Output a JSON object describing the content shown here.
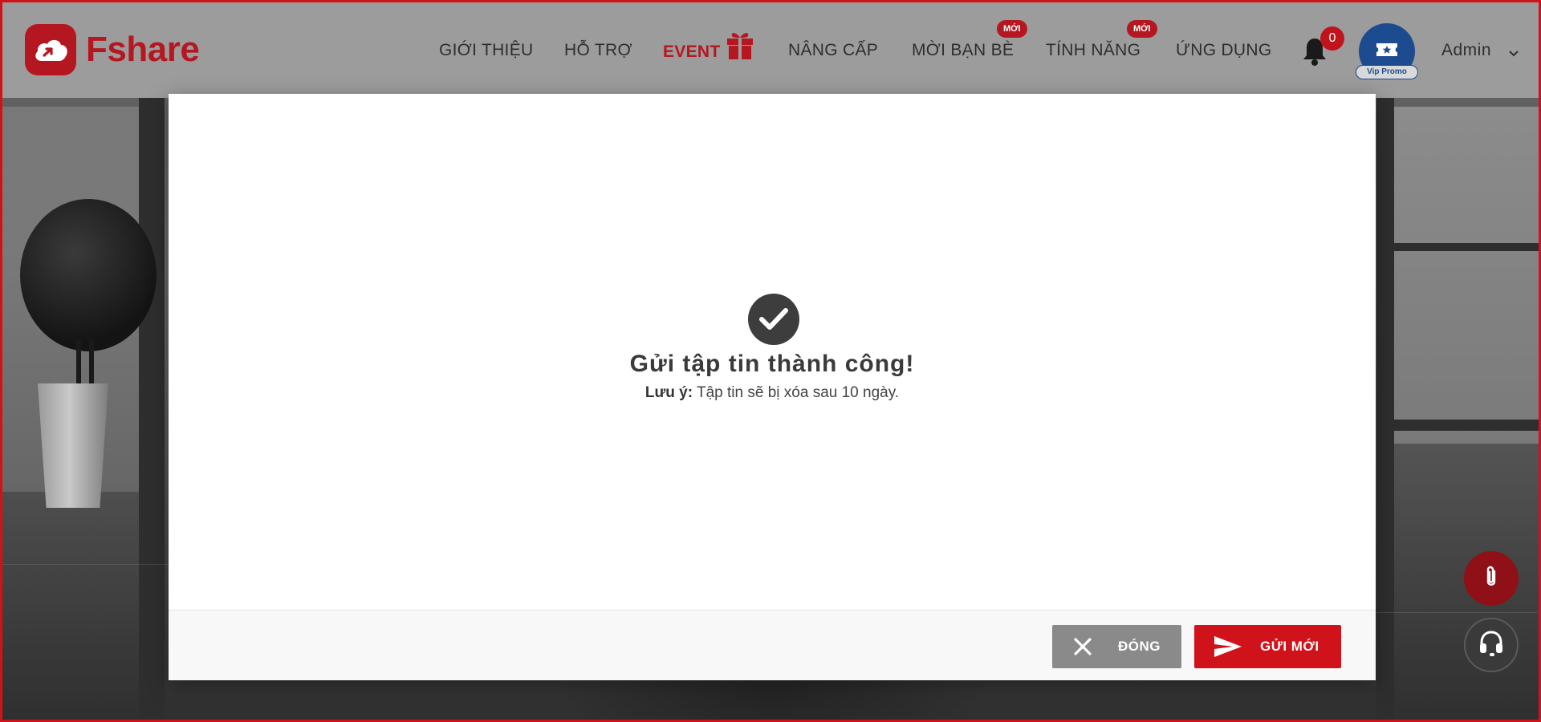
{
  "brand": {
    "name": "Fshare",
    "color": "#b51720"
  },
  "nav": {
    "items": [
      {
        "label": "GIỚI THIỆU"
      },
      {
        "label": "HỖ TRỢ"
      },
      {
        "label": "EVENT"
      },
      {
        "label": "NÂNG CẤP"
      },
      {
        "label": "MỜI BẠN BÈ",
        "badge": "MỚI"
      },
      {
        "label": "TÍNH NĂNG",
        "badge": "MỚI"
      },
      {
        "label": "ỨNG DỤNG"
      }
    ]
  },
  "notifications": {
    "count": "0"
  },
  "user": {
    "name": "Admin",
    "tag": "Vip Promo"
  },
  "modal": {
    "title": "Gửi tập tin thành công!",
    "note_label": "Lưu ý:",
    "note_text": " Tập tin sẽ bị xóa sau 10 ngày.",
    "close_label": "ĐÓNG",
    "send_new_label": "GỬI MỚI"
  },
  "colors": {
    "accent": "#d0121b",
    "close_button": "#8a8a8a"
  },
  "icons": {
    "logo": "cloud-upload-icon",
    "event": "gift-icon",
    "notifications": "bell-icon",
    "avatar": "ticket-star-icon",
    "success": "check-circle-icon",
    "close": "close-icon",
    "send": "send-icon",
    "attach": "paperclip-icon",
    "support": "headset-icon"
  }
}
